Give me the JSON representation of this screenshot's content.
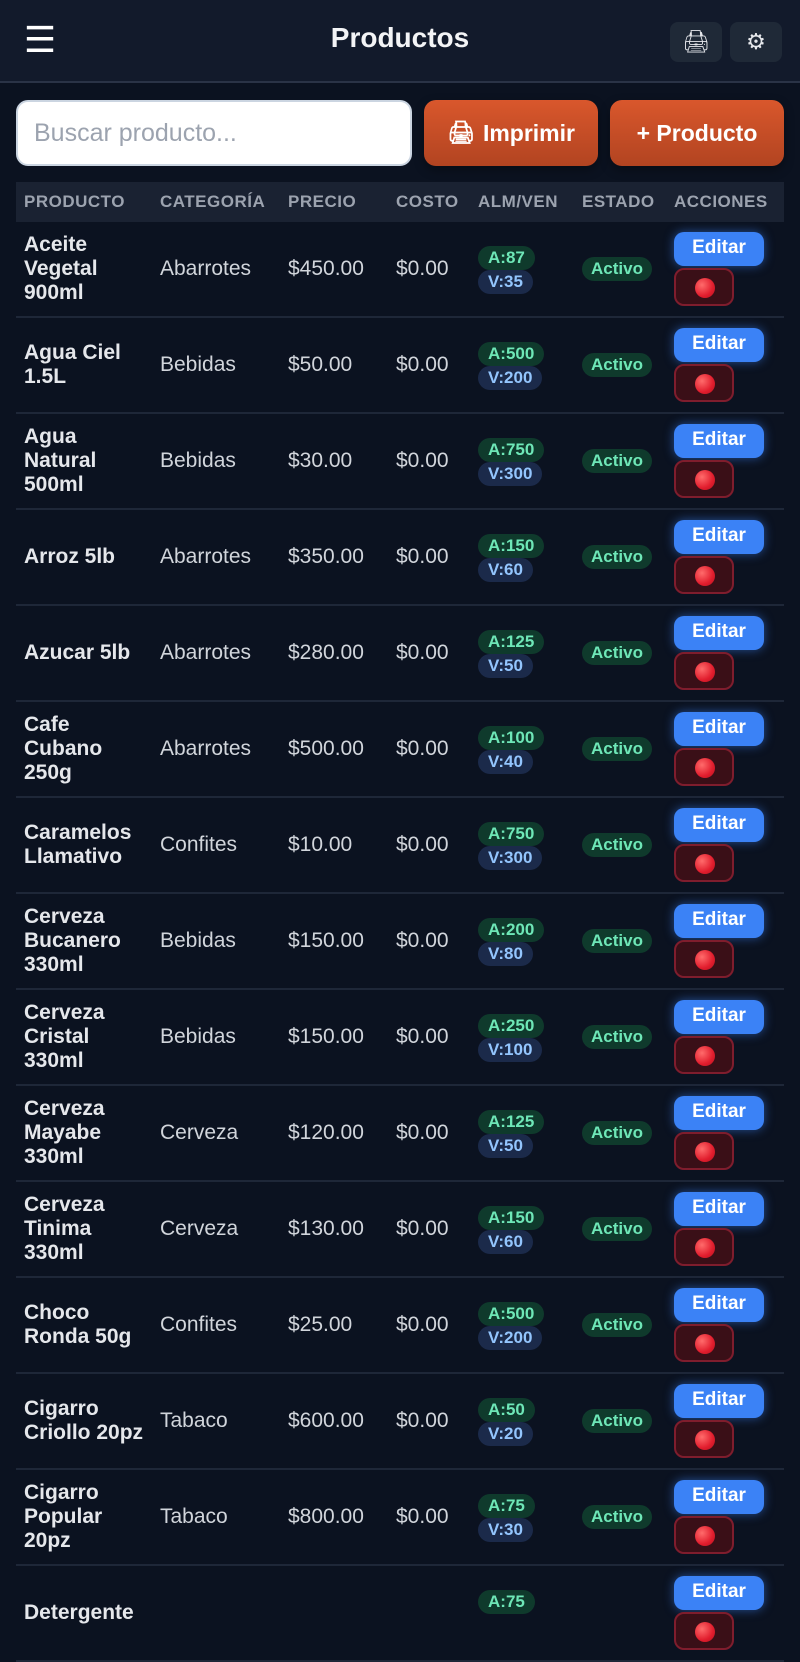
{
  "header": {
    "title": "Productos",
    "menu_icon": "☰",
    "print_icon": "🖨",
    "settings_icon": "⚙"
  },
  "toolbar": {
    "search_placeholder": "Buscar producto...",
    "print_icon": "🖨",
    "print_label": "Imprimir",
    "add_label": "+ Producto"
  },
  "table": {
    "headers": {
      "product": "PRODUCTO",
      "category": "CATEGORÍA",
      "price": "PRECIO",
      "cost": "COSTO",
      "stock": "ALM/VEN",
      "status": "ESTADO",
      "actions": "ACCIONES"
    },
    "edit_label": "Editar",
    "rows": [
      {
        "name": "Aceite Vegetal 900ml",
        "category": "Abarrotes",
        "price": "$450.00",
        "cost": "$0.00",
        "alm": "A:87",
        "ven": "V:35",
        "status": "Activo"
      },
      {
        "name": "Agua Ciel 1.5L",
        "category": "Bebidas",
        "price": "$50.00",
        "cost": "$0.00",
        "alm": "A:500",
        "ven": "V:200",
        "status": "Activo"
      },
      {
        "name": "Agua Natural 500ml",
        "category": "Bebidas",
        "price": "$30.00",
        "cost": "$0.00",
        "alm": "A:750",
        "ven": "V:300",
        "status": "Activo"
      },
      {
        "name": "Arroz 5lb",
        "category": "Abarrotes",
        "price": "$350.00",
        "cost": "$0.00",
        "alm": "A:150",
        "ven": "V:60",
        "status": "Activo"
      },
      {
        "name": "Azucar 5lb",
        "category": "Abarrotes",
        "price": "$280.00",
        "cost": "$0.00",
        "alm": "A:125",
        "ven": "V:50",
        "status": "Activo"
      },
      {
        "name": "Cafe Cubano 250g",
        "category": "Abarrotes",
        "price": "$500.00",
        "cost": "$0.00",
        "alm": "A:100",
        "ven": "V:40",
        "status": "Activo"
      },
      {
        "name": "Caramelos Llamativo",
        "category": "Confites",
        "price": "$10.00",
        "cost": "$0.00",
        "alm": "A:750",
        "ven": "V:300",
        "status": "Activo"
      },
      {
        "name": "Cerveza Bucanero 330ml",
        "category": "Bebidas",
        "price": "$150.00",
        "cost": "$0.00",
        "alm": "A:200",
        "ven": "V:80",
        "status": "Activo"
      },
      {
        "name": "Cerveza Cristal 330ml",
        "category": "Bebidas",
        "price": "$150.00",
        "cost": "$0.00",
        "alm": "A:250",
        "ven": "V:100",
        "status": "Activo"
      },
      {
        "name": "Cerveza Mayabe 330ml",
        "category": "Cerveza",
        "price": "$120.00",
        "cost": "$0.00",
        "alm": "A:125",
        "ven": "V:50",
        "status": "Activo"
      },
      {
        "name": "Cerveza Tinima 330ml",
        "category": "Cerveza",
        "price": "$130.00",
        "cost": "$0.00",
        "alm": "A:150",
        "ven": "V:60",
        "status": "Activo"
      },
      {
        "name": "Choco Ronda 50g",
        "category": "Confites",
        "price": "$25.00",
        "cost": "$0.00",
        "alm": "A:500",
        "ven": "V:200",
        "status": "Activo"
      },
      {
        "name": "Cigarro Criollo 20pz",
        "category": "Tabaco",
        "price": "$600.00",
        "cost": "$0.00",
        "alm": "A:50",
        "ven": "V:20",
        "status": "Activo"
      },
      {
        "name": "Cigarro Popular 20pz",
        "category": "Tabaco",
        "price": "$800.00",
        "cost": "$0.00",
        "alm": "A:75",
        "ven": "V:30",
        "status": "Activo"
      },
      {
        "name": "Detergente",
        "category": "",
        "price": "",
        "cost": "",
        "alm": "A:75",
        "ven": "",
        "status": ""
      }
    ]
  }
}
